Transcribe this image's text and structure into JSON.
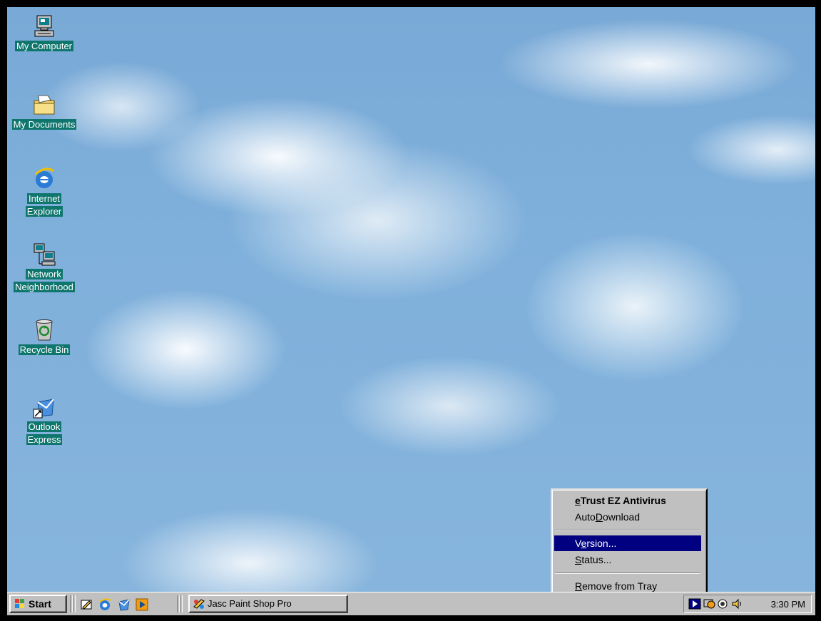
{
  "desktop": {
    "icons": [
      {
        "label": "My Computer",
        "icon": "computer-icon"
      },
      {
        "label": "My Documents",
        "icon": "folder-icon"
      },
      {
        "label1": "Internet",
        "label2": "Explorer",
        "icon": "internet-explorer-icon"
      },
      {
        "label1": "Network",
        "label2": "Neighborhood",
        "icon": "network-icon"
      },
      {
        "label": "Recycle Bin",
        "icon": "recycle-bin-icon"
      },
      {
        "label1": "Outlook",
        "label2": "Express",
        "icon": "outlook-express-icon"
      }
    ]
  },
  "context_menu": {
    "title_pre": "",
    "title_ul": "e",
    "title_post": "Trust EZ Antivirus",
    "autodownload_pre": "Auto",
    "autodownload_ul": "D",
    "autodownload_post": "ownload",
    "version_pre": "V",
    "version_ul": "e",
    "version_post": "rsion...",
    "status_ul": "S",
    "status_post": "tatus...",
    "remove_ul": "R",
    "remove_post": "emove from Tray",
    "selected_item": "Version..."
  },
  "taskbar": {
    "start_label": "Start",
    "quick_launch": [
      "show-desktop-icon",
      "internet-explorer-icon",
      "outlook-express-icon",
      "media-player-icon"
    ],
    "task_label": "Jasc Paint Shop Pro",
    "clock": "3:30 PM",
    "tray_icons": [
      "antivirus-tray-icon",
      "display-tray-icon",
      "network-tray-icon",
      "volume-icon"
    ]
  },
  "colors": {
    "selection": "#000080",
    "icon_label_bg": "#0f766e",
    "window_face": "#c0c0c0"
  }
}
